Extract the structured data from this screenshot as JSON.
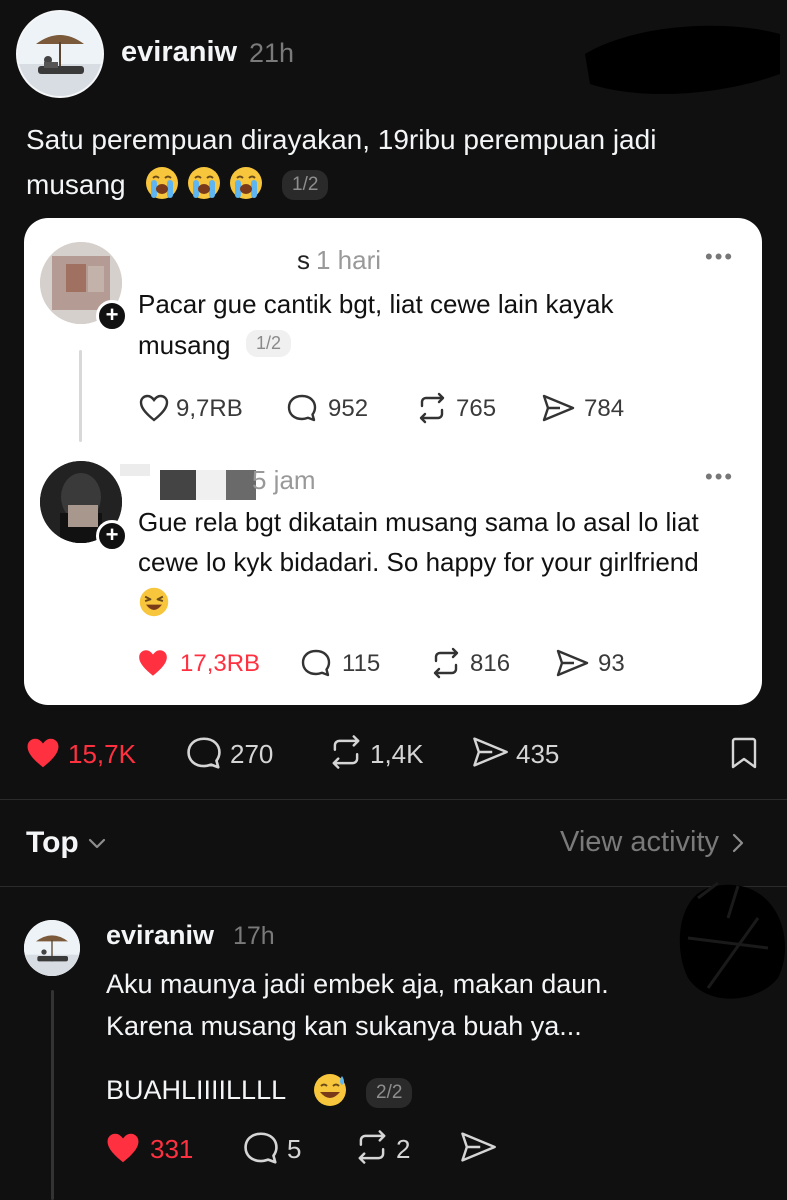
{
  "post": {
    "username": "eviraniw",
    "time": "21h",
    "text_line1": "Satu perempuan dirayakan, 19ribu perempuan jadi",
    "text_line2": "musang",
    "pager": "1/2",
    "likes": "15,7K",
    "replies": "270",
    "reposts": "1,4K",
    "shares": "435"
  },
  "quote": {
    "first": {
      "username_fragment": "s",
      "time": "1 hari",
      "text_line1": "Pacar gue cantik bgt, liat cewe lain kayak",
      "text_line2": "musang",
      "pager": "1/2",
      "likes": "9,7RB",
      "replies": "952",
      "reposts": "765",
      "shares": "784"
    },
    "second": {
      "time": "5 jam",
      "text_line1": "Gue rela bgt dikatain musang sama lo asal lo liat",
      "text_line2": "cewe lo kyk bidadari. So happy for your girlfriend",
      "likes": "17,3RB",
      "replies": "115",
      "reposts": "816",
      "shares": "93"
    }
  },
  "sort": {
    "label": "Top",
    "view_activity": "View activity"
  },
  "reply": {
    "username": "eviraniw",
    "time": "17h",
    "text_line1": "Aku maunya jadi embek aja, makan daun.",
    "text_line2": "Karena musang kan sukanya buah ya...",
    "text_line3": "BUAHLIIIILLLL",
    "pager": "2/2",
    "likes": "331",
    "replies": "5",
    "reposts": "2"
  },
  "colors": {
    "background": "#101010",
    "like_red": "#ff3040",
    "card_bg": "#ffffff"
  }
}
